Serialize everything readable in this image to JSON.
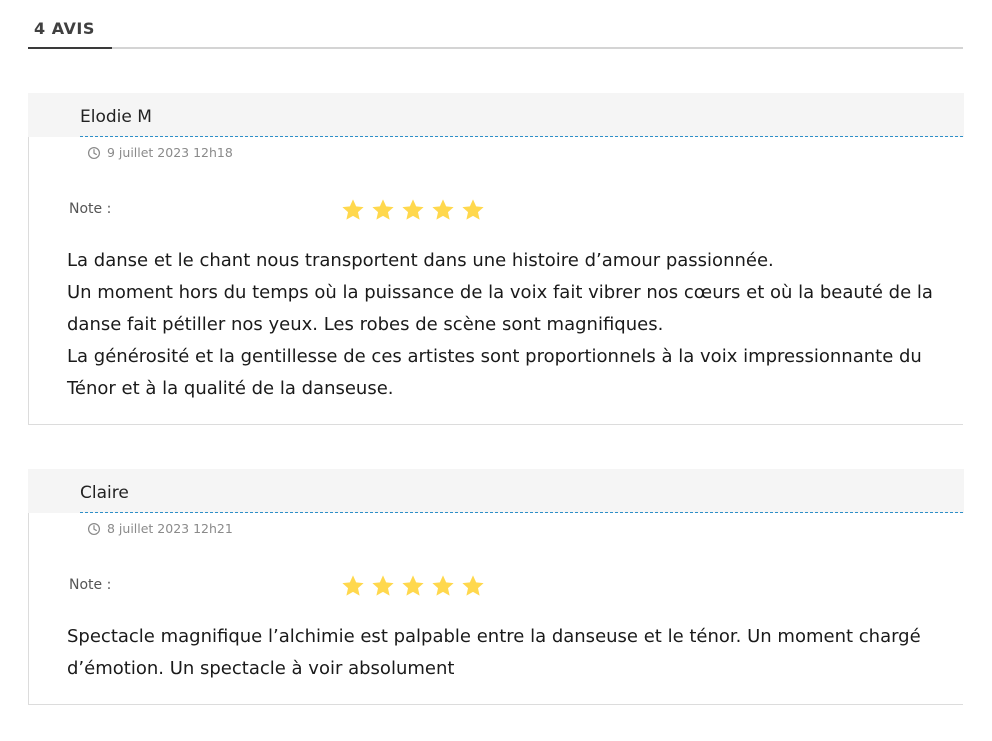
{
  "tabs": {
    "active_label": "4 AVIS"
  },
  "colors": {
    "star": "#ffd84d",
    "accent_dash": "#2e8fc8",
    "header_bg": "#f5f5f5"
  },
  "reviews": [
    {
      "author": "Elodie M",
      "date": "9 juillet 2023 12h18",
      "note_label": "Note :",
      "rating": 5,
      "rating_max": 5,
      "paragraphs": [
        "La danse et le chant nous transportent dans une histoire d’amour passionnée.",
        "Un moment hors du temps où la puissance de la voix fait vibrer nos cœurs et où la beauté de la danse fait pétiller nos yeux. Les robes de scène sont magnifiques.",
        "La générosité et la gentillesse de ces artistes sont proportionnels à la voix impressionnante du Ténor et à la qualité de la danseuse."
      ]
    },
    {
      "author": "Claire",
      "date": "8 juillet 2023 12h21",
      "note_label": "Note :",
      "rating": 5,
      "rating_max": 5,
      "paragraphs": [
        "Spectacle magnifique l’alchimie est palpable entre la danseuse et le ténor. Un moment chargé d’émotion. Un spectacle à voir absolument"
      ]
    }
  ],
  "icons": {
    "date": "clock-icon",
    "rating": "star-icon"
  }
}
